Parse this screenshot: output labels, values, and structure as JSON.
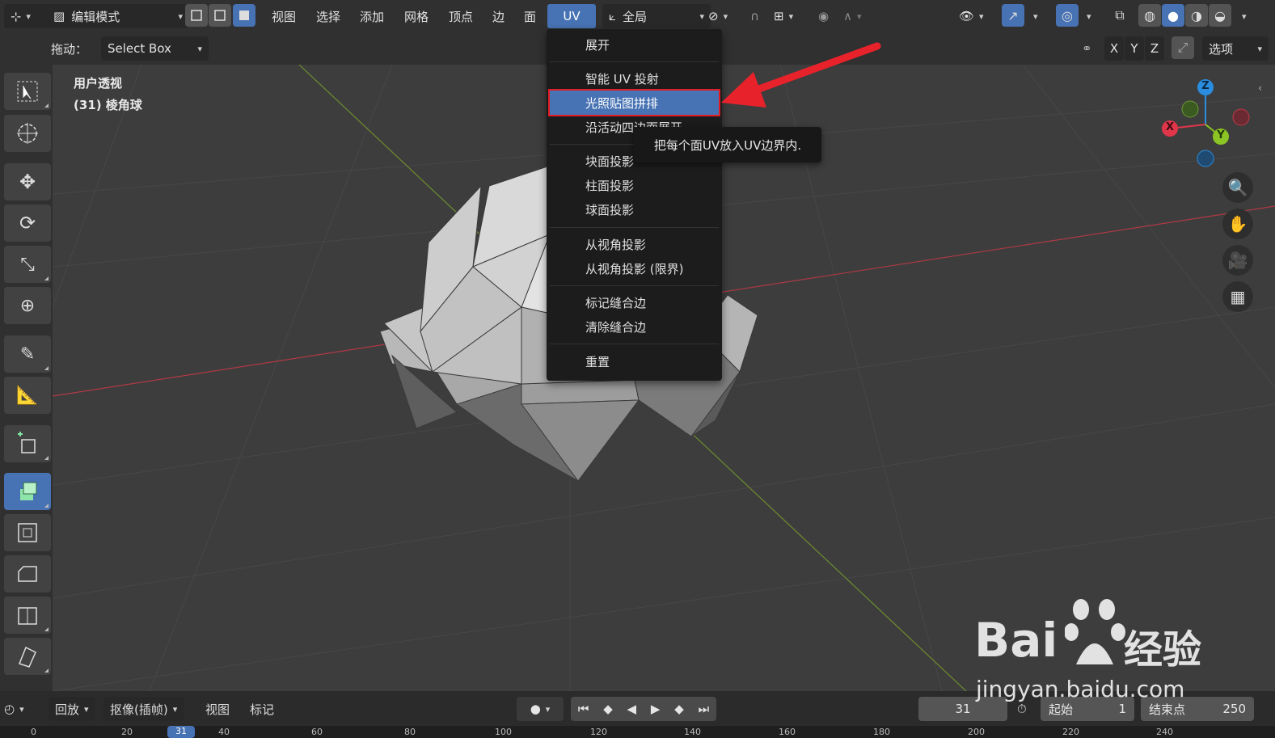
{
  "header": {
    "mode_label": "编辑模式",
    "menus": [
      "视图",
      "选择",
      "添加",
      "网格",
      "顶点",
      "边",
      "面",
      "UV"
    ],
    "active_menu": "UV",
    "orientation_label": "全局"
  },
  "subbar": {
    "drag_label": "拖动：",
    "drag_value": "Select Box",
    "axes": [
      "X",
      "Y",
      "Z"
    ],
    "options_label": "选项"
  },
  "viewport": {
    "view_name": "用户透视",
    "object_info": "(31) 棱角球"
  },
  "uv_menu": {
    "items": [
      {
        "label": "展开",
        "selected": false
      },
      {
        "label": "智能 UV 投射",
        "selected": false
      },
      {
        "label": "光照贴图拼排",
        "selected": true
      },
      {
        "label": "沿活动四边面展开",
        "selected": false
      },
      {
        "label": "块面投影",
        "selected": false
      },
      {
        "label": "柱面投影",
        "selected": false
      },
      {
        "label": "球面投影",
        "selected": false
      },
      {
        "label": "从视角投影",
        "selected": false
      },
      {
        "label": "从视角投影 (限界)",
        "selected": false
      },
      {
        "label": "标记缝合边",
        "selected": false
      },
      {
        "label": "清除缝合边",
        "selected": false
      },
      {
        "label": "重置",
        "selected": false
      }
    ]
  },
  "tooltip": {
    "text": "把每个面UV放入UV边界内."
  },
  "gizmo": {
    "x_label": "X",
    "y_label": "Y",
    "z_label": "Z",
    "colors": {
      "x": "#e0364a",
      "y": "#8bc424",
      "z": "#2a8de0"
    }
  },
  "timeline": {
    "playback_label": "回放",
    "keying_label": "抠像(插帧)",
    "view_label": "视图",
    "marker_label": "标记",
    "current_frame": "31",
    "start_label": "起始",
    "start_value": "1",
    "end_label": "结束点",
    "end_value": "250",
    "ruler_ticks": [
      "0",
      "20",
      "31",
      "40",
      "60",
      "80",
      "100",
      "120",
      "140",
      "160",
      "180",
      "200",
      "220",
      "240"
    ]
  },
  "watermark": {
    "brand": "Bai",
    "brand_suffix": "经验",
    "url": "jingyan.baidu.com"
  },
  "colors": {
    "accent": "#4772b3",
    "highlight_border": "#e21c24",
    "arrow": "#e8222b"
  }
}
